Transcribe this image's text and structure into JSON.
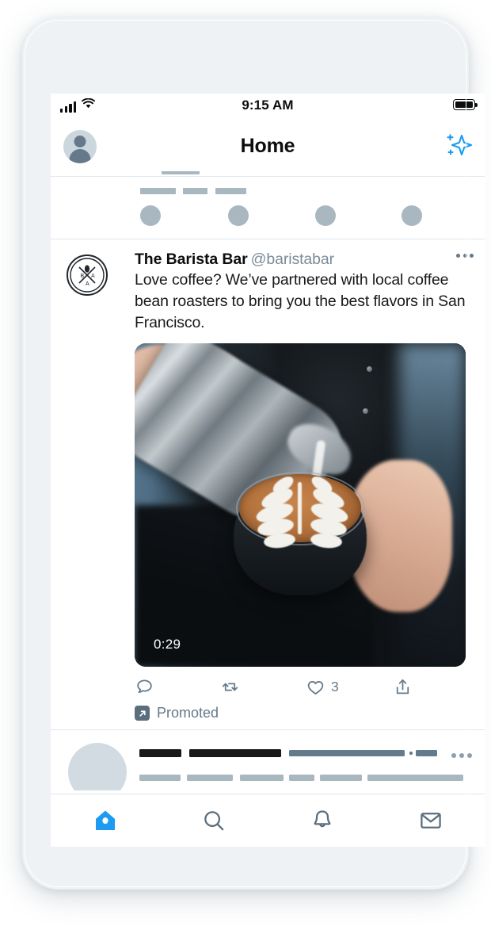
{
  "status_bar": {
    "time": "9:15 AM",
    "signal_icon": "cellular-signal-icon",
    "wifi_icon": "wifi-icon",
    "battery_icon": "battery-full-icon"
  },
  "header": {
    "title": "Home",
    "avatar_icon": "profile-avatar-icon",
    "sparkle_icon": "sparkle-icon",
    "accent_color": "#1d9bf0"
  },
  "tweet": {
    "author": "The Barista Bar",
    "handle": "@baristabar",
    "text": "Love coffee? We’ve partnered with local coffee bean roasters to bring you the best flavors in San Francisco.",
    "avatar_icon": "barista-bar-logo-icon",
    "menu_icon": "more-options-icon",
    "media": {
      "duration": "0:29",
      "description": "Barista pouring steamed milk from a metal pitcher into a glass cup of espresso, forming rosetta latte art",
      "play_state": "video"
    },
    "actions": {
      "reply": {
        "icon": "reply-icon",
        "count": ""
      },
      "retweet": {
        "icon": "retweet-icon",
        "count": ""
      },
      "like": {
        "icon": "like-heart-icon",
        "count": "3"
      },
      "share": {
        "icon": "share-icon",
        "count": ""
      }
    },
    "promoted": {
      "label": "Promoted",
      "icon": "promoted-arrow-icon"
    }
  },
  "tab_bar": {
    "items": [
      {
        "name": "home",
        "icon": "home-icon",
        "active": true
      },
      {
        "name": "search",
        "icon": "search-icon",
        "active": false
      },
      {
        "name": "notifications",
        "icon": "bell-icon",
        "active": false
      },
      {
        "name": "messages",
        "icon": "mail-icon",
        "active": false
      }
    ]
  },
  "colors": {
    "accent": "#1d9bf0",
    "text_primary": "#0b0d0f",
    "text_muted": "#64798a",
    "divider": "#e2e8ed",
    "skeleton": "#a9b7c1",
    "frame": "#eef2f4"
  }
}
